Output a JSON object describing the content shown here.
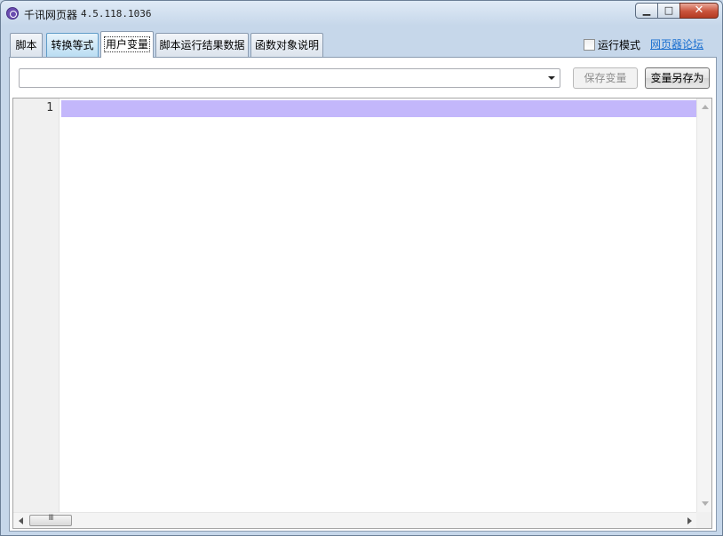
{
  "window": {
    "title": "千讯网页器",
    "version": "4.5.118.1036",
    "minimize_glyph": "▁",
    "maximize_glyph": "□",
    "close_glyph": "✕"
  },
  "tabs": [
    {
      "label": "脚本"
    },
    {
      "label": "转换等式"
    },
    {
      "label": "用户变量"
    },
    {
      "label": "脚本运行结果数据"
    },
    {
      "label": "函数对象说明"
    }
  ],
  "active_tab": "用户变量",
  "header_right": {
    "run_mode_label": "运行模式",
    "forum_link": "网页器论坛"
  },
  "toolbar": {
    "variable_select_value": "",
    "save_button": "保存变量",
    "save_as_button": "变量另存为"
  },
  "editor": {
    "line_numbers": [
      "1"
    ],
    "content": "",
    "current_line_color": "#c3b7fb"
  },
  "scrollbar": {
    "thumb_grip": "III"
  }
}
